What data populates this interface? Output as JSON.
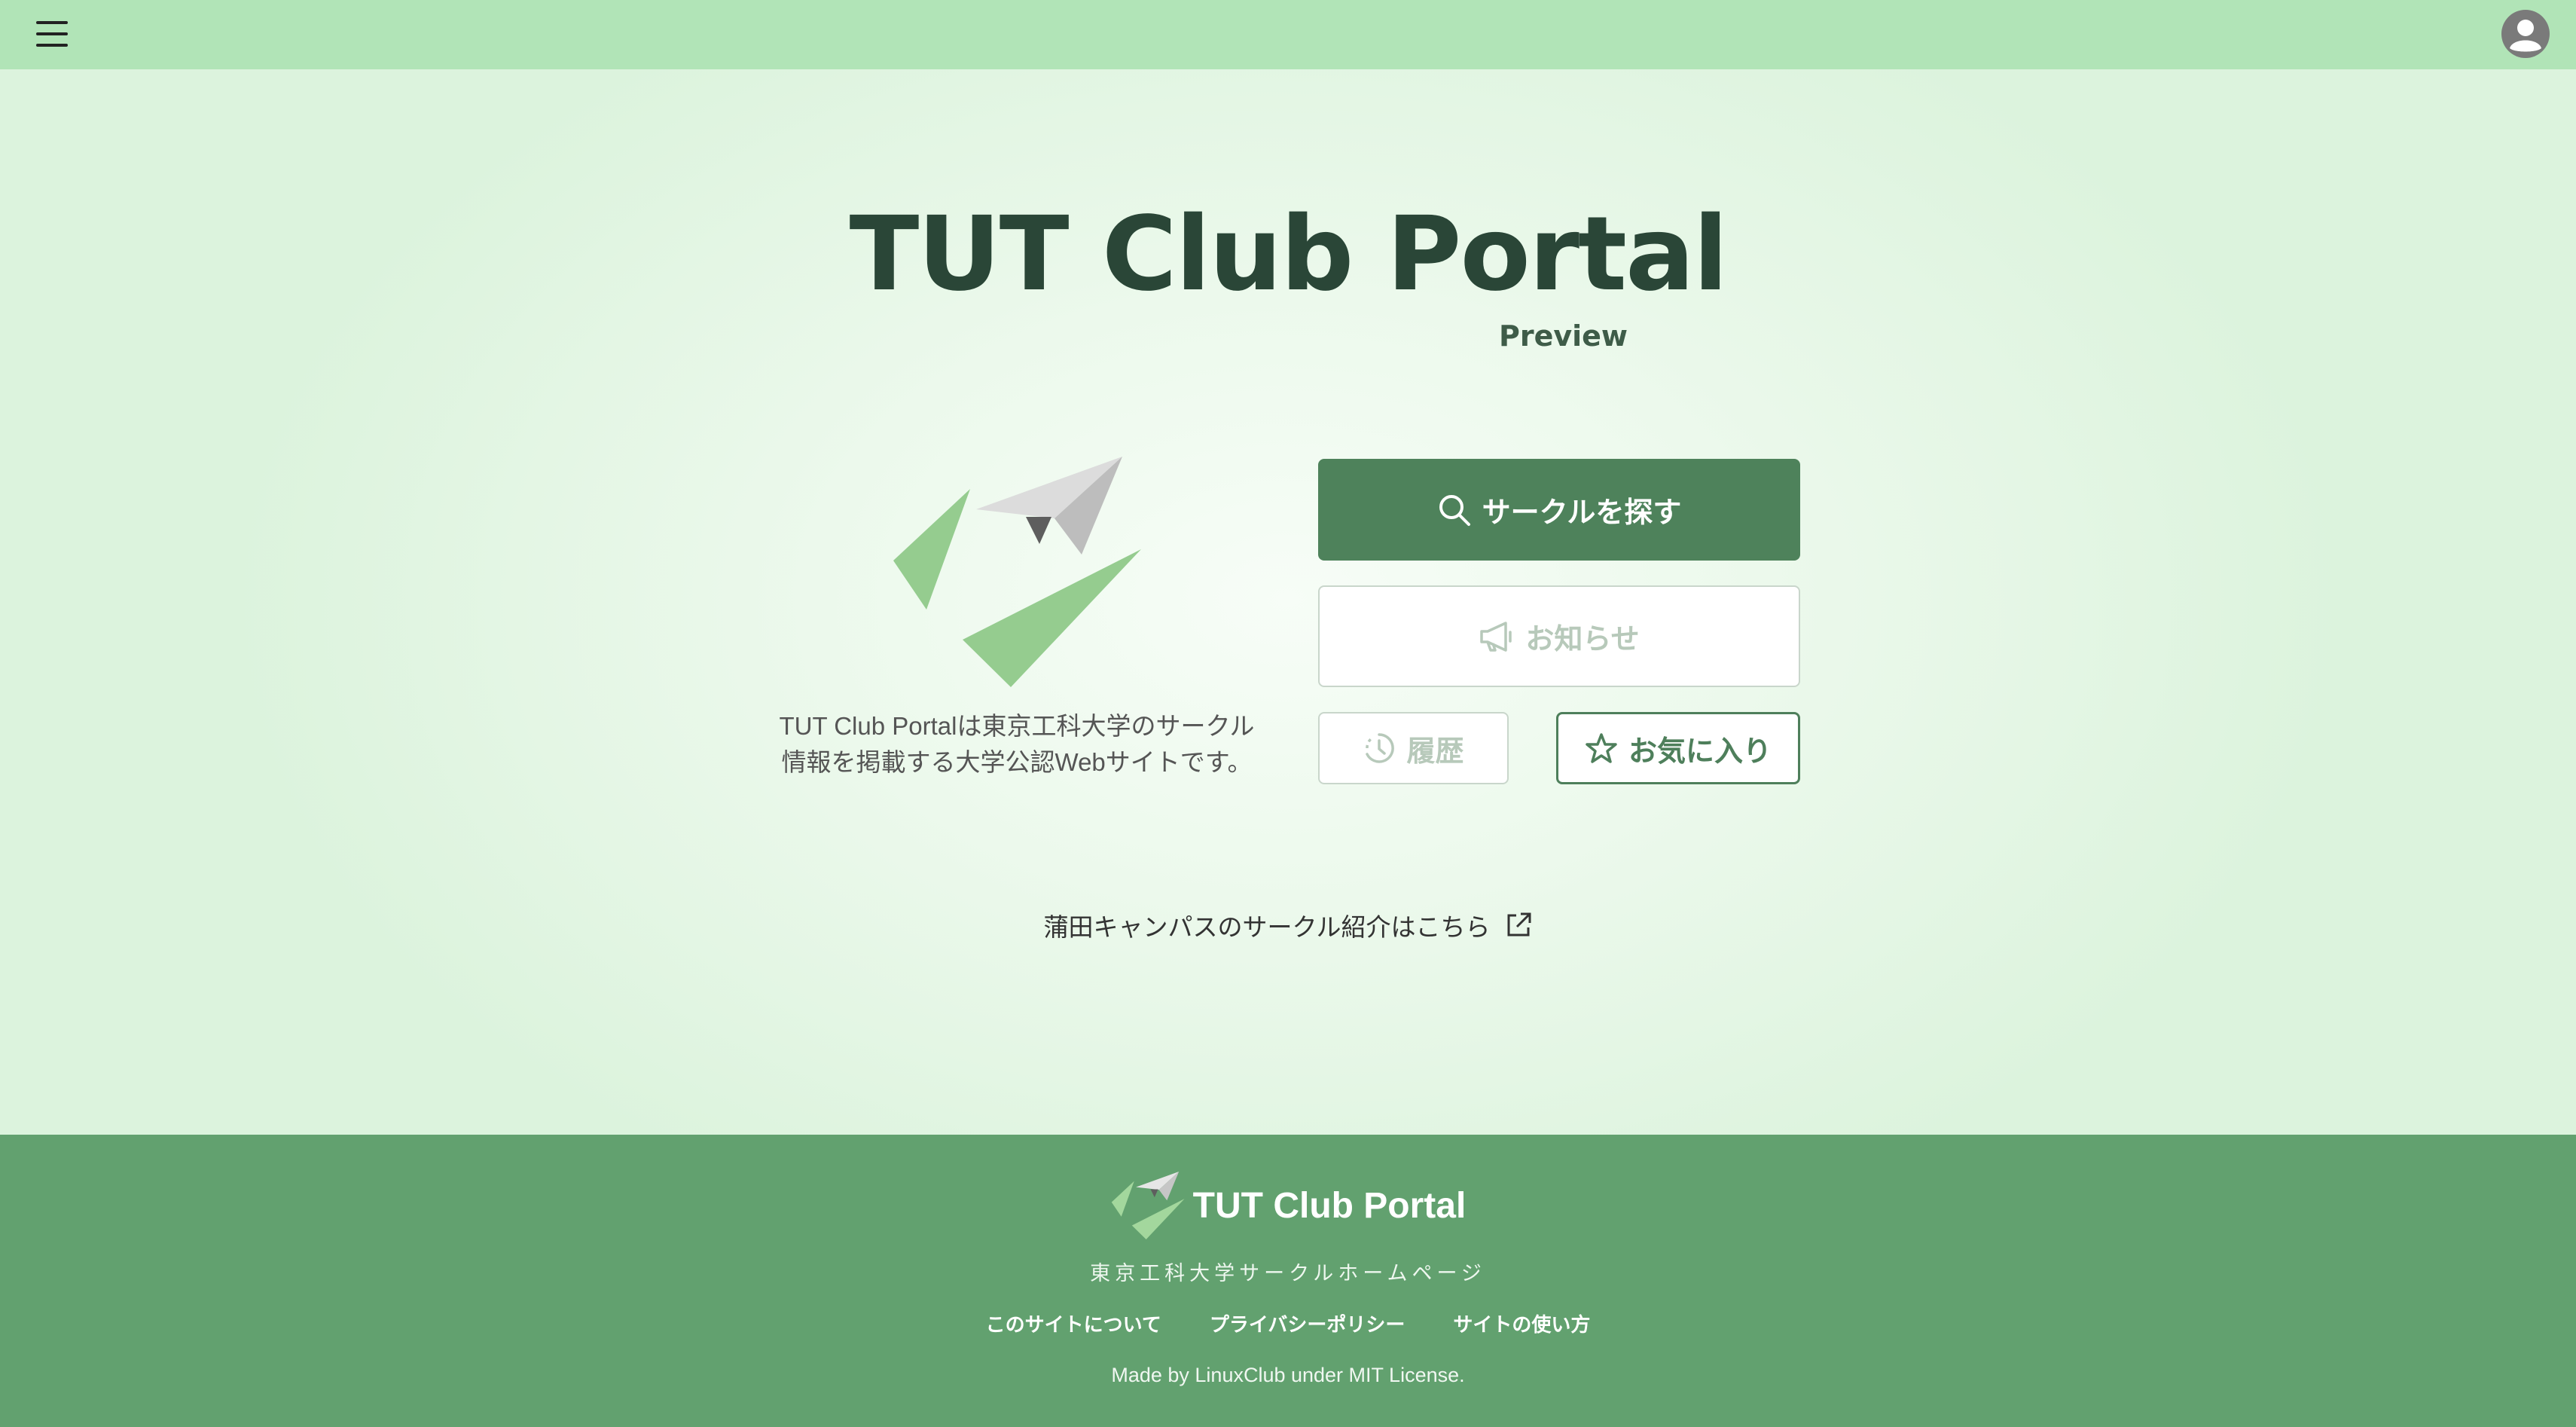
{
  "header": {
    "menu_icon": "hamburger-menu-icon",
    "account_icon": "user-account-icon"
  },
  "hero": {
    "title": "TUT Club Portal",
    "badge": "Preview",
    "description_line1": "TUT Club Portalは東京工科大学のサークル",
    "description_line2": "情報を掲載する大学公認Webサイトです。"
  },
  "actions": {
    "search_label": "サークルを探す",
    "news_label": "お知らせ",
    "history_label": "履歴",
    "favorites_label": "お気に入り"
  },
  "campus_link": {
    "label": "蒲田キャンパスのサークル紹介はこちら",
    "icon": "external-link-icon"
  },
  "footer": {
    "brand": "TUT Club Portal",
    "subtitle": "東京工科大学サークルホームページ",
    "links": [
      "このサイトについて",
      "プライバシーポリシー",
      "サイトの使い方"
    ],
    "copyright": "Made by LinuxClub under MIT License."
  },
  "colors": {
    "header_bg": "#b1e4b7",
    "primary": "#4e825b",
    "footer_bg": "#62a16f",
    "title_text": "#2a4637",
    "disabled": "#b7c9ba"
  }
}
